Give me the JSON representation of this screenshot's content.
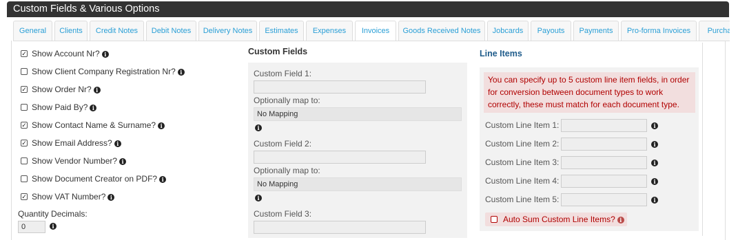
{
  "header": {
    "title": "Custom Fields & Various Options"
  },
  "tabs": [
    {
      "label": "General",
      "active": false
    },
    {
      "label": "Clients",
      "active": false
    },
    {
      "label": "Credit Notes",
      "active": false
    },
    {
      "label": "Debit Notes",
      "active": false
    },
    {
      "label": "Delivery Notes",
      "active": false
    },
    {
      "label": "Estimates",
      "active": false
    },
    {
      "label": "Expenses",
      "active": false
    },
    {
      "label": "Invoices",
      "active": true
    },
    {
      "label": "Goods Received Notes",
      "active": false
    },
    {
      "label": "Jobcards",
      "active": false
    },
    {
      "label": "Payouts",
      "active": false
    },
    {
      "label": "Payments",
      "active": false
    },
    {
      "label": "Pro-forma Invoices",
      "active": false
    },
    {
      "label": "Purcha",
      "active": false
    }
  ],
  "options": [
    {
      "label": "Show Account Nr?",
      "checked": true
    },
    {
      "label": "Show Client Company Registration Nr?",
      "checked": false
    },
    {
      "label": "Show Order Nr?",
      "checked": true
    },
    {
      "label": "Show Paid By?",
      "checked": false
    },
    {
      "label": "Show Contact Name & Surname?",
      "checked": true
    },
    {
      "label": "Show Email Address?",
      "checked": true
    },
    {
      "label": "Show Vendor Number?",
      "checked": false
    },
    {
      "label": "Show Document Creator on PDF?",
      "checked": false
    },
    {
      "label": "Show VAT Number?",
      "checked": true
    }
  ],
  "quantity_decimals": {
    "label": "Quantity Decimals:",
    "value": "0"
  },
  "custom_fields": {
    "title": "Custom Fields",
    "field1_label": "Custom Field 1:",
    "field2_label": "Custom Field 2:",
    "field3_label": "Custom Field 3:",
    "map_label": "Optionally map to:",
    "map1_value": "No Mapping",
    "map2_value": "No Mapping"
  },
  "line_items": {
    "title": "Line Items",
    "alert": "You can specify up to 5 custom line item fields, in order for conversion between document types to work correctly, these must match for each document type.",
    "rows": [
      {
        "label": "Custom Line Item 1:"
      },
      {
        "label": "Custom Line Item 2:"
      },
      {
        "label": "Custom Line Item 3:"
      },
      {
        "label": "Custom Line Item 4:"
      },
      {
        "label": "Custom Line Item 5:"
      }
    ],
    "auto_sum_label": "Auto Sum Custom Line Items?",
    "auto_sum_checked": false
  },
  "colors": {
    "accent": "#2a9fd6",
    "header_bg": "#333333",
    "alert_bg": "#f2dede",
    "alert_text": "#b00000"
  }
}
